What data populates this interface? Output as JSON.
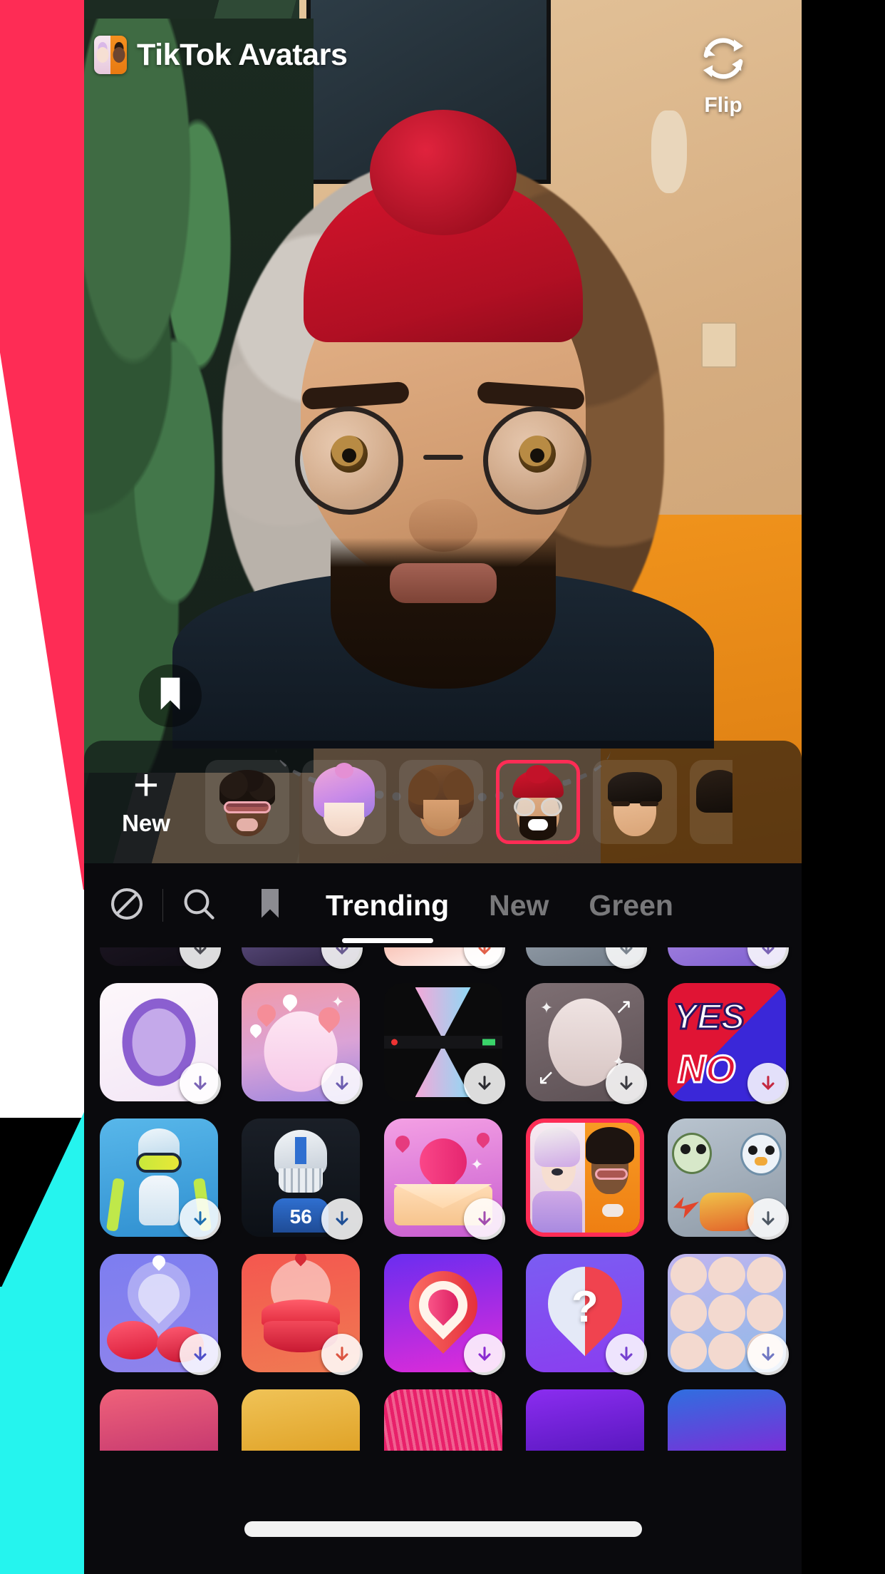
{
  "app": {
    "title": "TikTok Avatars",
    "icon_name": "tiktok-avatars-app-icon"
  },
  "header": {
    "flip_label": "Flip",
    "flip_icon": "refresh-flip-icon"
  },
  "camera": {
    "bookmark_icon": "bookmark-icon"
  },
  "avatar_carousel": {
    "new_label": "New",
    "new_plus": "+",
    "avatars": [
      {
        "name": "avatar-curly-red-glasses",
        "selected": false,
        "skin": "#6b4630",
        "hair": "#1d1410",
        "accent": "#e06a7a"
      },
      {
        "name": "avatar-pink-bob",
        "selected": false,
        "skin": "#f6e0d3",
        "hair": "#c77fe0",
        "accent": "#b06ad8"
      },
      {
        "name": "avatar-curly-brown",
        "selected": false,
        "skin": "#c98f65",
        "hair": "#4d3020",
        "accent": "#6b4324"
      },
      {
        "name": "avatar-red-beanie-glasses",
        "selected": true,
        "skin": "#dba77c",
        "hair": "#c31229",
        "accent": "#1c1109"
      },
      {
        "name": "avatar-short-black-hair",
        "selected": false,
        "skin": "#e6bd96",
        "hair": "#1a1512",
        "accent": "#1a1512"
      },
      {
        "name": "avatar-partial",
        "selected": false,
        "skin": "#3a2a1e",
        "hair": "#120d09",
        "accent": "#120d09"
      }
    ]
  },
  "effects_panel": {
    "tools": [
      {
        "name": "clear-effect-icon",
        "label": ""
      },
      {
        "name": "search-icon",
        "label": ""
      },
      {
        "name": "bookmark-icon",
        "label": ""
      }
    ],
    "categories": [
      {
        "label": "Trending",
        "active": true
      },
      {
        "label": "New",
        "active": false
      },
      {
        "label": "Green",
        "active": false
      }
    ],
    "rows": [
      {
        "clipped": true,
        "cells": [
          {
            "name": "effect-clipped-1",
            "downloadable": true,
            "selected": false
          },
          {
            "name": "effect-clipped-2",
            "downloadable": true,
            "selected": false
          },
          {
            "name": "effect-clipped-3",
            "downloadable": true,
            "selected": false
          },
          {
            "name": "effect-clipped-4",
            "downloadable": true,
            "selected": false
          },
          {
            "name": "effect-clipped-5",
            "downloadable": true,
            "selected": false
          }
        ]
      },
      {
        "clipped": false,
        "cells": [
          {
            "name": "effect-purple-face-frame",
            "downloadable": true,
            "selected": false
          },
          {
            "name": "effect-pink-hearts-glow",
            "downloadable": true,
            "selected": false
          },
          {
            "name": "effect-hourglass-gradient",
            "downloadable": true,
            "selected": false
          },
          {
            "name": "effect-silver-sparkle-face",
            "downloadable": true,
            "selected": false
          },
          {
            "name": "effect-yes-no",
            "downloadable": true,
            "selected": false,
            "text_top": "YES",
            "text_bottom": "NO"
          }
        ]
      },
      {
        "clipped": false,
        "cells": [
          {
            "name": "effect-ski-jumper",
            "downloadable": true,
            "selected": false
          },
          {
            "name": "effect-football-helmet",
            "downloadable": true,
            "selected": false,
            "jersey_number": "56"
          },
          {
            "name": "effect-heart-envelope",
            "downloadable": true,
            "selected": false
          },
          {
            "name": "effect-tiktok-avatars",
            "downloadable": false,
            "selected": true
          },
          {
            "name": "effect-pokemon-starters",
            "downloadable": true,
            "selected": false
          }
        ]
      },
      {
        "clipped": false,
        "cells": [
          {
            "name": "effect-kiss-lips-blue",
            "downloadable": true,
            "selected": false
          },
          {
            "name": "effect-red-lips",
            "downloadable": true,
            "selected": false
          },
          {
            "name": "effect-nested-hearts",
            "downloadable": true,
            "selected": false
          },
          {
            "name": "effect-question-heart",
            "downloadable": true,
            "selected": false
          },
          {
            "name": "effect-smiley-grid",
            "downloadable": true,
            "selected": false
          }
        ]
      },
      {
        "clipped": true,
        "cells": [
          {
            "name": "effect-bottom-1",
            "downloadable": false,
            "selected": false
          },
          {
            "name": "effect-bottom-2",
            "downloadable": false,
            "selected": false
          },
          {
            "name": "effect-bottom-3",
            "downloadable": false,
            "selected": false
          },
          {
            "name": "effect-bottom-4",
            "downloadable": false,
            "selected": false
          },
          {
            "name": "effect-bottom-5",
            "downloadable": false,
            "selected": false
          }
        ]
      }
    ]
  },
  "colors": {
    "brand_pink": "#FE2C55",
    "brand_cyan": "#25F4EE",
    "panel_bg": "#0a0a0d",
    "accent_white": "#FFFFFF"
  }
}
